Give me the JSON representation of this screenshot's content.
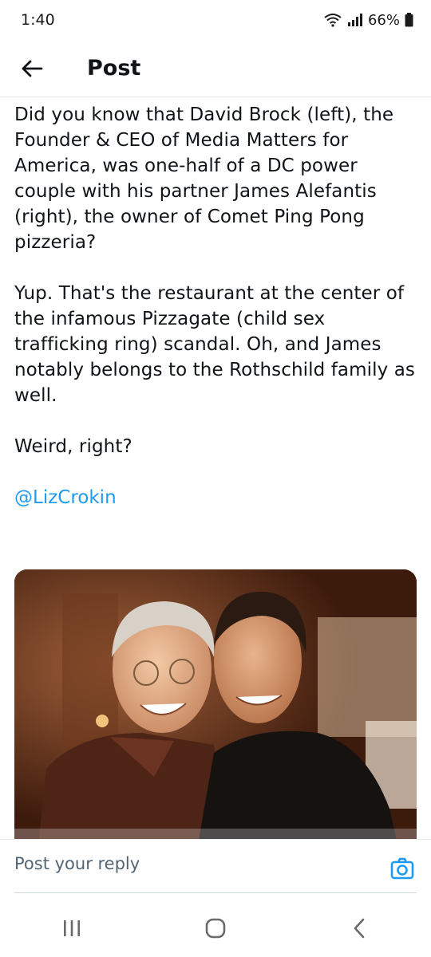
{
  "status_bar": {
    "time": "1:40",
    "battery": "66%",
    "icons": [
      "wifi-icon",
      "signal-icon",
      "battery-icon"
    ]
  },
  "header": {
    "title": "Post",
    "back_icon": "arrow-left-icon"
  },
  "post": {
    "paragraphs": [
      "Did you know that David Brock (left), the Founder & CEO of Media Matters for America, was one-half of a DC power couple with his partner James Alefantis (right), the owner of Comet Ping Pong pizzeria?",
      "Yup.  That's the restaurant at the center of the infamous Pizzagate (child sex trafficking ring) scandal.  Oh, and James notably belongs to the Rothschild family as well.",
      "Weird, right?"
    ],
    "mention": "@LizCrokin"
  },
  "reply": {
    "placeholder": "Post your reply",
    "camera_icon": "camera-icon"
  },
  "nav": {
    "icons": [
      "recent-apps-icon",
      "home-icon",
      "back-icon"
    ]
  },
  "colors": {
    "accent": "#1d9bf0",
    "text": "#0f1419",
    "muted": "#536471"
  }
}
